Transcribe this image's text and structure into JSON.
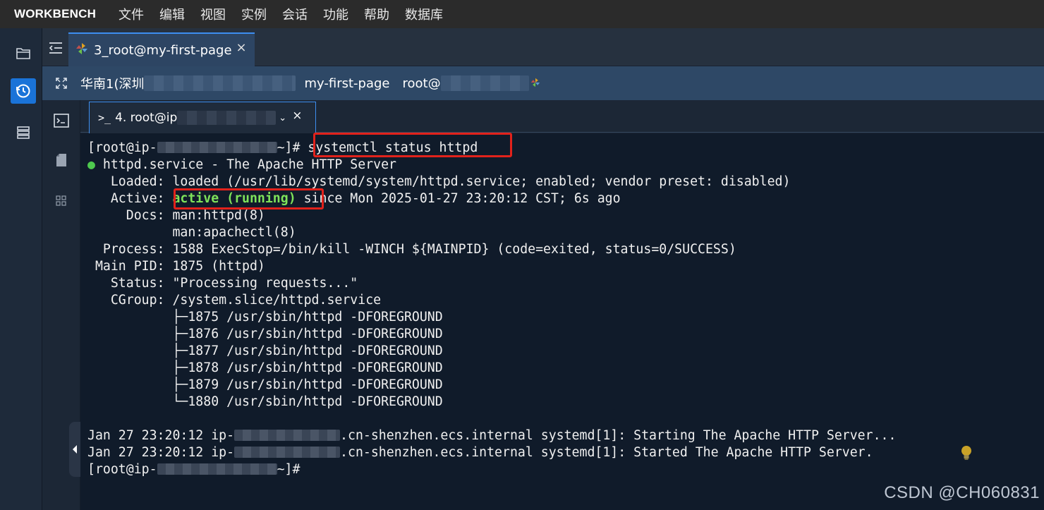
{
  "menubar": {
    "brand": "WORKBENCH",
    "items": [
      "文件",
      "编辑",
      "视图",
      "实例",
      "会话",
      "功能",
      "帮助",
      "数据库"
    ]
  },
  "session_tab": {
    "label": "3_root@my-first-page",
    "close": "×"
  },
  "infobar": {
    "region": "华南1(深圳",
    "instance": "my-first-page",
    "user": "root@"
  },
  "terminal_tab": {
    "label": "4. root@ip",
    "chevron": "⌄",
    "close": "×"
  },
  "terminal": {
    "prompt_prefix": "[root@ip-",
    "prompt_suffix": "~]#",
    "command": "systemctl status httpd",
    "lines": {
      "service": "httpd.service - The Apache HTTP Server",
      "loaded": "   Loaded: loaded (/usr/lib/systemd/system/httpd.service; enabled; vendor preset: disabled)",
      "active_label": "   Active: ",
      "active_state": "active (running)",
      "active_rest": " since Mon 2025-01-27 23:20:12 CST; 6s ago",
      "docs1": "     Docs: man:httpd(8)",
      "docs2": "           man:apachectl(8)",
      "process": "  Process: 1588 ExecStop=/bin/kill -WINCH ${MAINPID} (code=exited, status=0/SUCCESS)",
      "mainpid": " Main PID: 1875 (httpd)",
      "status": "   Status: \"Processing requests...\"",
      "cgroup": "   CGroup: /system.slice/httpd.service",
      "proc1": "           ├─1875 /usr/sbin/httpd -DFOREGROUND",
      "proc2": "           ├─1876 /usr/sbin/httpd -DFOREGROUND",
      "proc3": "           ├─1877 /usr/sbin/httpd -DFOREGROUND",
      "proc4": "           ├─1878 /usr/sbin/httpd -DFOREGROUND",
      "proc5": "           ├─1879 /usr/sbin/httpd -DFOREGROUND",
      "proc6": "           └─1880 /usr/sbin/httpd -DFOREGROUND",
      "log1_prefix": "Jan 27 23:20:12 ip-",
      "log1_suffix": ".cn-shenzhen.ecs.internal systemd[1]: Starting The Apache HTTP Server...",
      "log2_prefix": "Jan 27 23:20:12 ip-",
      "log2_suffix": ".cn-shenzhen.ecs.internal systemd[1]: Started The Apache HTTP Server."
    }
  },
  "watermark": "CSDN @CH060831",
  "colors": {
    "highlight_box": "#e2221b",
    "active_green": "#7fe25a",
    "accent_blue": "#1a73d8"
  }
}
